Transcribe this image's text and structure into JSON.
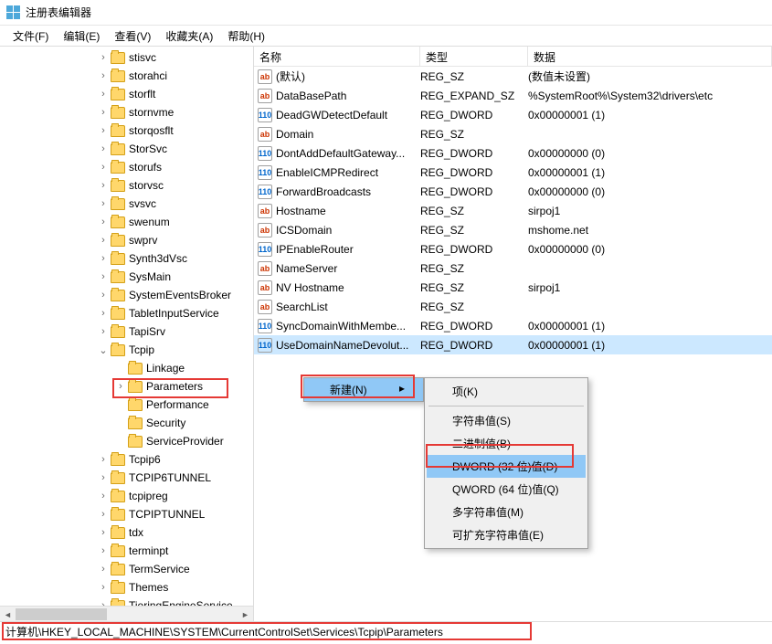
{
  "title": "注册表编辑器",
  "menu": [
    "文件(F)",
    "编辑(E)",
    "查看(V)",
    "收藏夹(A)",
    "帮助(H)"
  ],
  "tree": [
    {
      "indent": 105,
      "exp": "›",
      "label": "stisvc"
    },
    {
      "indent": 105,
      "exp": "›",
      "label": "storahci"
    },
    {
      "indent": 105,
      "exp": "›",
      "label": "storflt"
    },
    {
      "indent": 105,
      "exp": "›",
      "label": "stornvme"
    },
    {
      "indent": 105,
      "exp": "›",
      "label": "storqosflt"
    },
    {
      "indent": 105,
      "exp": "›",
      "label": "StorSvc"
    },
    {
      "indent": 105,
      "exp": "›",
      "label": "storufs"
    },
    {
      "indent": 105,
      "exp": "›",
      "label": "storvsc"
    },
    {
      "indent": 105,
      "exp": "›",
      "label": "svsvc"
    },
    {
      "indent": 105,
      "exp": "›",
      "label": "swenum"
    },
    {
      "indent": 105,
      "exp": "›",
      "label": "swprv"
    },
    {
      "indent": 105,
      "exp": "›",
      "label": "Synth3dVsc"
    },
    {
      "indent": 105,
      "exp": "›",
      "label": "SysMain"
    },
    {
      "indent": 105,
      "exp": "›",
      "label": "SystemEventsBroker"
    },
    {
      "indent": 105,
      "exp": "›",
      "label": "TabletInputService"
    },
    {
      "indent": 105,
      "exp": "›",
      "label": "TapiSrv"
    },
    {
      "indent": 105,
      "exp": "⌄",
      "label": "Tcpip"
    },
    {
      "indent": 124,
      "exp": "",
      "label": "Linkage"
    },
    {
      "indent": 124,
      "exp": "›",
      "label": "Parameters",
      "highlight": true
    },
    {
      "indent": 124,
      "exp": "",
      "label": "Performance"
    },
    {
      "indent": 124,
      "exp": "",
      "label": "Security"
    },
    {
      "indent": 124,
      "exp": "",
      "label": "ServiceProvider"
    },
    {
      "indent": 105,
      "exp": "›",
      "label": "Tcpip6"
    },
    {
      "indent": 105,
      "exp": "›",
      "label": "TCPIP6TUNNEL"
    },
    {
      "indent": 105,
      "exp": "›",
      "label": "tcpipreg"
    },
    {
      "indent": 105,
      "exp": "›",
      "label": "TCPIPTUNNEL"
    },
    {
      "indent": 105,
      "exp": "›",
      "label": "tdx"
    },
    {
      "indent": 105,
      "exp": "›",
      "label": "terminpt"
    },
    {
      "indent": 105,
      "exp": "›",
      "label": "TermService"
    },
    {
      "indent": 105,
      "exp": "›",
      "label": "Themes"
    },
    {
      "indent": 105,
      "exp": "›",
      "label": "TieringEngineService"
    }
  ],
  "columns": {
    "name": "名称",
    "type": "类型",
    "data": "数据"
  },
  "values": [
    {
      "icon": "str",
      "name": "(默认)",
      "type": "REG_SZ",
      "data": "(数值未设置)"
    },
    {
      "icon": "str",
      "name": "DataBasePath",
      "type": "REG_EXPAND_SZ",
      "data": "%SystemRoot%\\System32\\drivers\\etc"
    },
    {
      "icon": "num",
      "name": "DeadGWDetectDefault",
      "type": "REG_DWORD",
      "data": "0x00000001 (1)"
    },
    {
      "icon": "str",
      "name": "Domain",
      "type": "REG_SZ",
      "data": ""
    },
    {
      "icon": "num",
      "name": "DontAddDefaultGateway...",
      "type": "REG_DWORD",
      "data": "0x00000000 (0)"
    },
    {
      "icon": "num",
      "name": "EnableICMPRedirect",
      "type": "REG_DWORD",
      "data": "0x00000001 (1)"
    },
    {
      "icon": "num",
      "name": "ForwardBroadcasts",
      "type": "REG_DWORD",
      "data": "0x00000000 (0)"
    },
    {
      "icon": "str",
      "name": "Hostname",
      "type": "REG_SZ",
      "data": "sirpoj1"
    },
    {
      "icon": "str",
      "name": "ICSDomain",
      "type": "REG_SZ",
      "data": "mshome.net"
    },
    {
      "icon": "num",
      "name": "IPEnableRouter",
      "type": "REG_DWORD",
      "data": "0x00000000 (0)"
    },
    {
      "icon": "str",
      "name": "NameServer",
      "type": "REG_SZ",
      "data": ""
    },
    {
      "icon": "str",
      "name": "NV Hostname",
      "type": "REG_SZ",
      "data": "sirpoj1"
    },
    {
      "icon": "str",
      "name": "SearchList",
      "type": "REG_SZ",
      "data": ""
    },
    {
      "icon": "num",
      "name": "SyncDomainWithMembe...",
      "type": "REG_DWORD",
      "data": "0x00000001 (1)"
    },
    {
      "icon": "num",
      "name": "UseDomainNameDevolut...",
      "type": "REG_DWORD",
      "data": "0x00000001 (1)",
      "selected": true
    }
  ],
  "ctx1": {
    "label": "新建(N)",
    "arrow": "▸"
  },
  "ctx2": [
    {
      "label": "项(K)"
    },
    {
      "sep": true
    },
    {
      "label": "字符串值(S)"
    },
    {
      "label": "二进制值(B)"
    },
    {
      "label": "DWORD (32 位)值(D)",
      "highlight": true
    },
    {
      "label": "QWORD (64 位)值(Q)"
    },
    {
      "label": "多字符串值(M)"
    },
    {
      "label": "可扩充字符串值(E)"
    }
  ],
  "statusbar": "计算机\\HKEY_LOCAL_MACHINE\\SYSTEM\\CurrentControlSet\\Services\\Tcpip\\Parameters"
}
